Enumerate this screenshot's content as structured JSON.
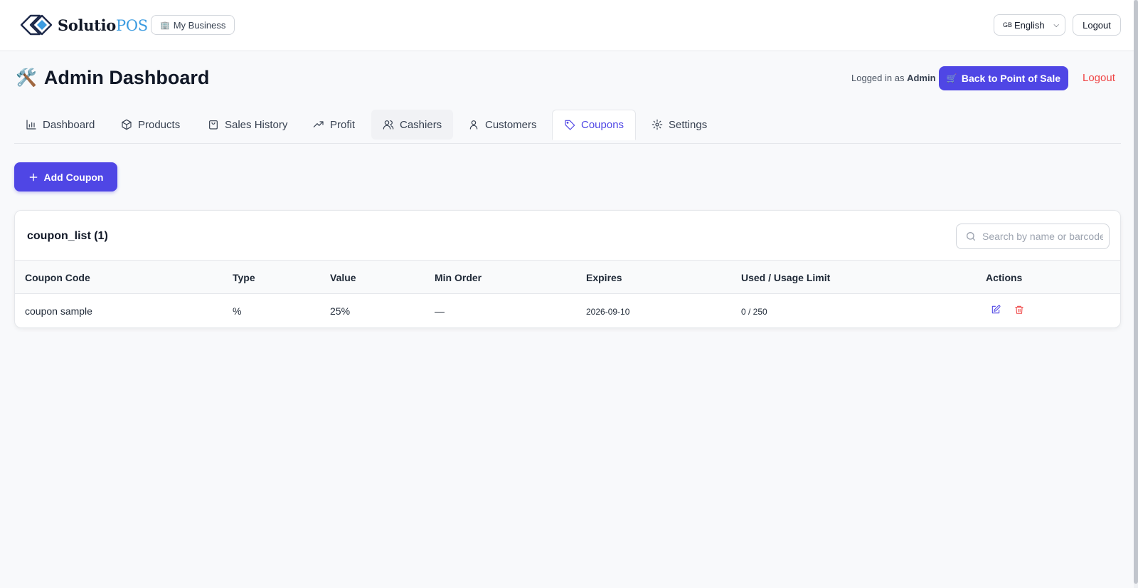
{
  "app": {
    "logo_primary": "Solutio",
    "logo_accent": "POS",
    "business_button": "My Business",
    "language": "English",
    "language_flag": "GB",
    "logout": "Logout"
  },
  "header": {
    "emoji": "🛠️",
    "title": "Admin Dashboard",
    "logged_prefix": "Logged in as",
    "logged_user": "Admin",
    "back_button": "Back to Point of Sale",
    "logout": "Logout"
  },
  "tabs": [
    {
      "label": "Dashboard",
      "icon": "bar-chart-icon"
    },
    {
      "label": "Products",
      "icon": "box-icon"
    },
    {
      "label": "Sales History",
      "icon": "shopping-bag-icon"
    },
    {
      "label": "Profit",
      "icon": "trending-up-icon"
    },
    {
      "label": "Cashiers",
      "icon": "users-icon"
    },
    {
      "label": "Customers",
      "icon": "user-icon"
    },
    {
      "label": "Coupons",
      "icon": "tag-icon"
    },
    {
      "label": "Settings",
      "icon": "gear-icon"
    }
  ],
  "active_tab": "Coupons",
  "add_button": "Add Coupon",
  "list": {
    "title": "coupon_list (1)",
    "search_placeholder": "Search by name or barcode",
    "columns": [
      "Coupon Code",
      "Type",
      "Value",
      "Min Order",
      "Expires",
      "Used / Usage Limit",
      "Actions"
    ],
    "rows": [
      {
        "code": "coupon sample",
        "type": "%",
        "value": "25%",
        "min_order": "—",
        "expires": "2026-09-10",
        "usage": "0 / 250"
      }
    ]
  },
  "colors": {
    "accent": "#4f46e5",
    "danger": "#ef4444",
    "logo_accent": "#3b9be0"
  }
}
